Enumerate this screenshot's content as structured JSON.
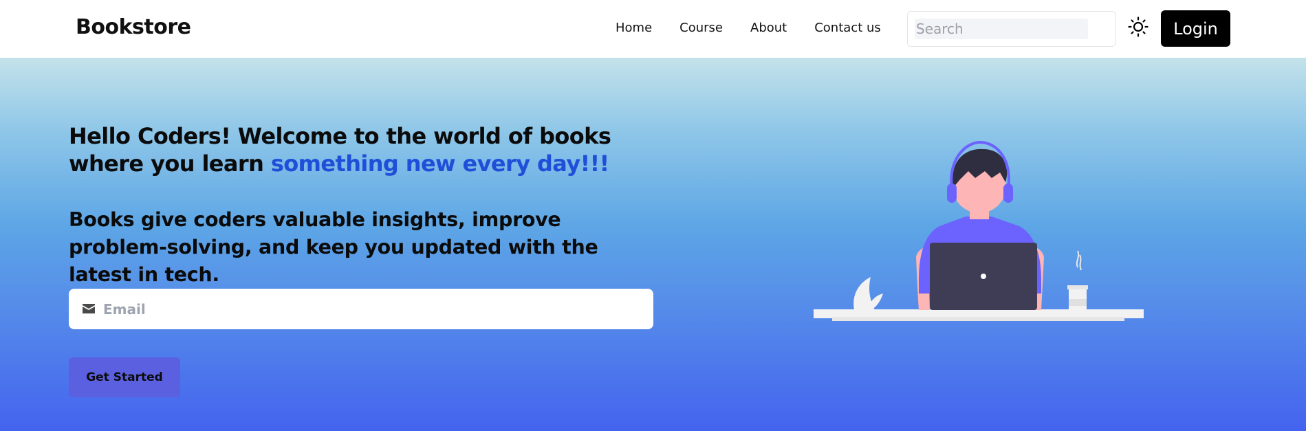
{
  "navbar": {
    "brand": "Bookstore",
    "links": [
      "Home",
      "Course",
      "About",
      "Contact us"
    ],
    "search_placeholder": "Search",
    "theme_toggle_icon": "sun-icon",
    "login_label": "Login"
  },
  "hero": {
    "headline_main": "Hello Coders! Welcome to the world of books where you learn ",
    "headline_accent": "something new every day!!!",
    "subtext": "Books give coders valuable insights, improve problem-solving, and keep you updated with the latest in tech.",
    "email_placeholder": "Email",
    "email_icon": "envelope-icon",
    "cta_label": "Get Started",
    "illustration": "person-with-laptop-illustration"
  },
  "colors": {
    "accent_text": "#1f4fd8",
    "cta_bg": "#5b60e0",
    "illustration_purple": "#6c63ff",
    "laptop": "#3f3d56"
  }
}
